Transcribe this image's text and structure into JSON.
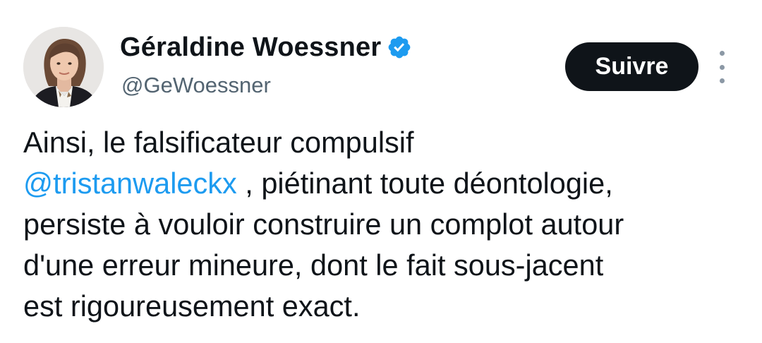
{
  "author": {
    "display_name": "Géraldine Woessner",
    "handle": "@GeWoessner",
    "verified": true,
    "avatar_icon": "profile-photo"
  },
  "actions": {
    "follow_label": "Suivre",
    "more_icon": "vertical-ellipsis-icon"
  },
  "tweet": {
    "line1": "Ainsi, le falsificateur compulsif",
    "mention": "@tristanwaleckx",
    "line2_rest": " , piétinant toute déontologie,",
    "line3": "persiste à vouloir construire un complot autour",
    "line4": "d'une erreur mineure, dont le fait sous-jacent",
    "line5": "est rigoureusement exact."
  },
  "colors": {
    "text": "#0f1419",
    "secondary": "#536471",
    "link": "#1d9bf0",
    "verified_badge": "#1d9bf0",
    "button_bg": "#0f1419",
    "button_text": "#ffffff"
  }
}
